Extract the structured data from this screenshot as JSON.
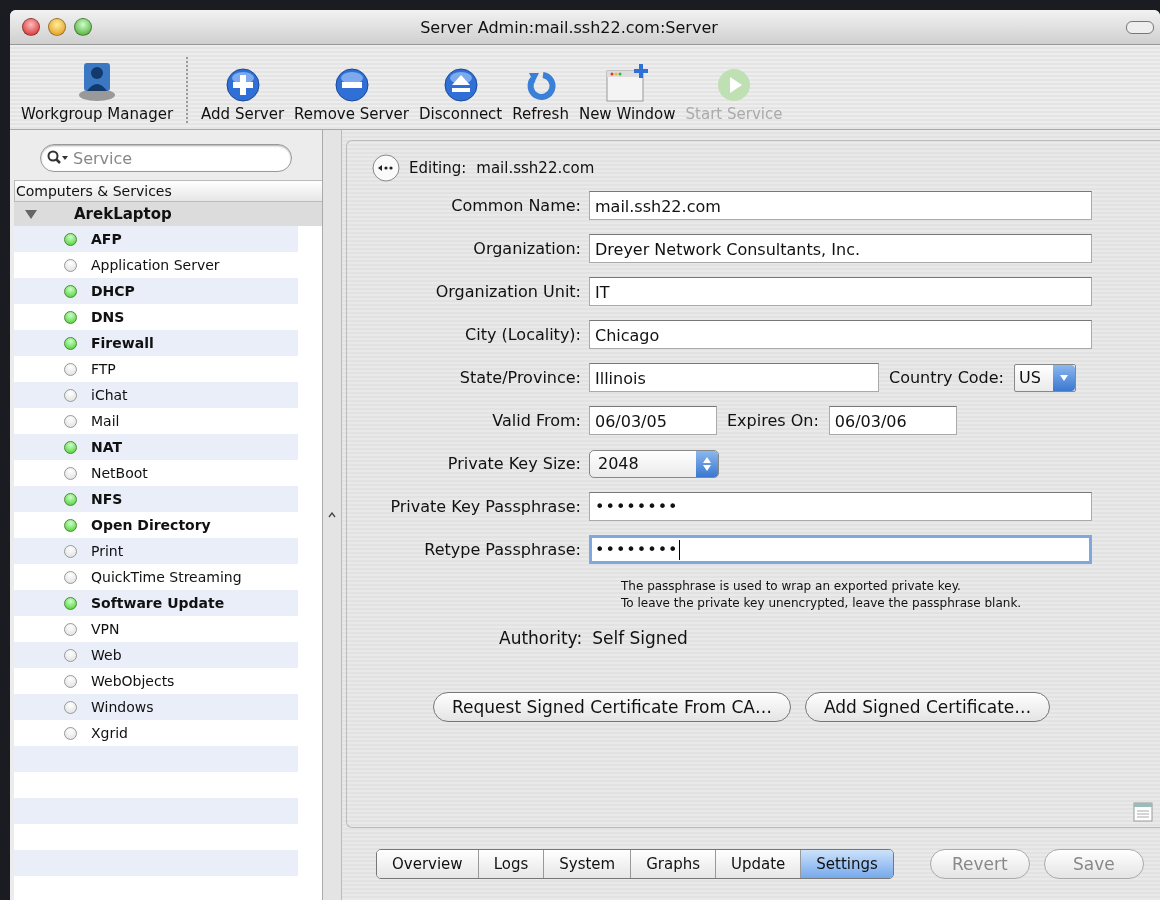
{
  "window": {
    "title": "Server Admin:mail.ssh22.com:Server"
  },
  "toolbar": [
    {
      "label": "Workgroup Manager",
      "kind": "workgroup",
      "disabled": false
    },
    {
      "label": "Add Server",
      "kind": "add",
      "disabled": false
    },
    {
      "label": "Remove Server",
      "kind": "remove",
      "disabled": false
    },
    {
      "label": "Disconnect",
      "kind": "eject",
      "disabled": false
    },
    {
      "label": "Refresh",
      "kind": "refresh",
      "disabled": false
    },
    {
      "label": "New Window",
      "kind": "window",
      "disabled": false
    },
    {
      "label": "Start Service",
      "kind": "start",
      "disabled": true
    }
  ],
  "sidebar": {
    "search": {
      "placeholder": "Service"
    },
    "header": "Computers & Services",
    "computer": {
      "name": "ArekLaptop",
      "expanded": true,
      "children": [
        {
          "name": "AFP",
          "running": true
        },
        {
          "name": "Application Server",
          "running": false
        },
        {
          "name": "DHCP",
          "running": true
        },
        {
          "name": "DNS",
          "running": true
        },
        {
          "name": "Firewall",
          "running": true
        },
        {
          "name": "FTP",
          "running": false
        },
        {
          "name": "iChat",
          "running": false
        },
        {
          "name": "Mail",
          "running": false
        },
        {
          "name": "NAT",
          "running": true
        },
        {
          "name": "NetBoot",
          "running": false
        },
        {
          "name": "NFS",
          "running": true
        },
        {
          "name": "Open Directory",
          "running": true
        },
        {
          "name": "Print",
          "running": false
        },
        {
          "name": "QuickTime Streaming",
          "running": false
        },
        {
          "name": "Software Update",
          "running": true
        },
        {
          "name": "VPN",
          "running": false
        },
        {
          "name": "Web",
          "running": false
        },
        {
          "name": "WebObjects",
          "running": false
        },
        {
          "name": "Windows",
          "running": false
        },
        {
          "name": "Xgrid",
          "running": false
        }
      ]
    }
  },
  "editor": {
    "heading_label": "Editing:",
    "heading_value": "mail.ssh22.com",
    "fields": [
      {
        "kind": "text",
        "label": "Common Name:",
        "value": "mail.ssh22.com"
      },
      {
        "kind": "text",
        "label": "Organization:",
        "value": "Dreyer Network Consultants, Inc."
      },
      {
        "kind": "text",
        "label": "Organization Unit:",
        "value": "IT"
      },
      {
        "kind": "text",
        "label": "City (Locality):",
        "value": "Chicago"
      },
      {
        "kind": "state",
        "label": "State/Province:",
        "value": "Illinois",
        "extra_label": "Country Code:",
        "extra_value": "US"
      },
      {
        "kind": "dates",
        "label": "Valid From:",
        "value": "06/03/05",
        "extra_label": "Expires On:",
        "extra_value": "06/03/06"
      },
      {
        "kind": "popup",
        "label": "Private Key Size:",
        "value": "2048"
      },
      {
        "kind": "password",
        "label": "Private Key Passphrase:",
        "value": "••••••••",
        "focused": false
      },
      {
        "kind": "password",
        "label": "Retype Passphrase:",
        "value": "••••••••",
        "focused": true
      }
    ],
    "hint": [
      "The passphrase is used to wrap an exported private key.",
      "To leave the private key unencrypted, leave the passphrase blank."
    ],
    "authority_label": "Authority:",
    "authority_value": "Self Signed",
    "buttons": [
      "Request Signed Certificate From CA…",
      "Add Signed Certificate…"
    ]
  },
  "tabs": [
    {
      "label": "Overview",
      "selected": false
    },
    {
      "label": "Logs",
      "selected": false
    },
    {
      "label": "System",
      "selected": false
    },
    {
      "label": "Graphs",
      "selected": false
    },
    {
      "label": "Update",
      "selected": false
    },
    {
      "label": "Settings",
      "selected": true
    }
  ],
  "actions": [
    {
      "label": "Revert",
      "disabled": true
    },
    {
      "label": "Save",
      "disabled": true
    }
  ]
}
